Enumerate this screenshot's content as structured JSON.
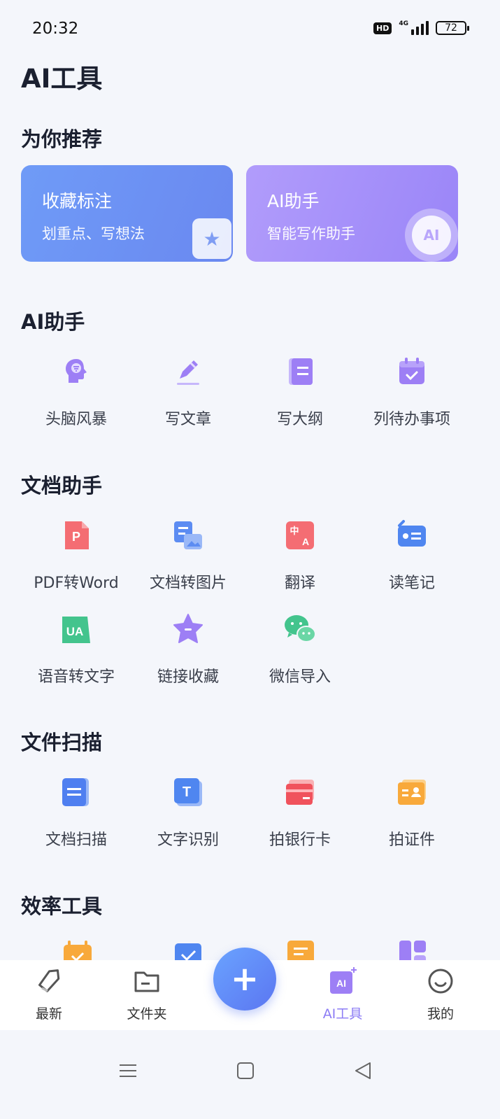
{
  "status": {
    "time": "20:32",
    "hd": "HD",
    "network": "4G",
    "battery": "72"
  },
  "page_title": "AI工具",
  "recommend": {
    "title": "为你推荐",
    "cards": [
      {
        "title": "收藏标注",
        "subtitle": "划重点、写想法",
        "icon": "star-icon"
      },
      {
        "title": "AI助手",
        "subtitle": "智能写作助手",
        "icon": "ai-badge-icon",
        "badge": "AI"
      }
    ]
  },
  "sections": [
    {
      "title": "AI助手",
      "items": [
        {
          "label": "头脑风暴",
          "icon": "brain-icon"
        },
        {
          "label": "写文章",
          "icon": "pencil-icon"
        },
        {
          "label": "写大纲",
          "icon": "outline-icon"
        },
        {
          "label": "列待办事项",
          "icon": "calendar-check-icon"
        }
      ]
    },
    {
      "title": "文档助手",
      "items": [
        {
          "label": "PDF转Word",
          "icon": "pdf-icon",
          "glyph": "P"
        },
        {
          "label": "文档转图片",
          "icon": "doc-to-image-icon"
        },
        {
          "label": "翻译",
          "icon": "translate-icon",
          "glyph": "中A"
        },
        {
          "label": "读笔记",
          "icon": "read-notes-icon"
        },
        {
          "label": "语音转文字",
          "icon": "voice-to-text-icon",
          "glyph": "UA"
        },
        {
          "label": "链接收藏",
          "icon": "link-star-icon"
        },
        {
          "label": "微信导入",
          "icon": "wechat-icon"
        }
      ]
    },
    {
      "title": "文件扫描",
      "items": [
        {
          "label": "文档扫描",
          "icon": "doc-scan-icon"
        },
        {
          "label": "文字识别",
          "icon": "text-recognition-icon",
          "glyph": "T"
        },
        {
          "label": "拍银行卡",
          "icon": "bank-card-icon"
        },
        {
          "label": "拍证件",
          "icon": "id-card-icon"
        }
      ]
    },
    {
      "title": "效率工具",
      "items": []
    }
  ],
  "bottom_nav": [
    {
      "label": "最新",
      "icon": "tag-icon"
    },
    {
      "label": "文件夹",
      "icon": "folder-icon"
    },
    {
      "label": "AI工具",
      "icon": "ai-tools-icon",
      "glyph": "AI",
      "active": true
    },
    {
      "label": "我的",
      "icon": "smile-icon"
    }
  ],
  "fab": {
    "glyph": "+"
  },
  "colors": {
    "accent": "#8c7cf5",
    "blue_card": "#6f9bf7",
    "purple_card": "#a995fa",
    "background": "#f4f6fb"
  }
}
